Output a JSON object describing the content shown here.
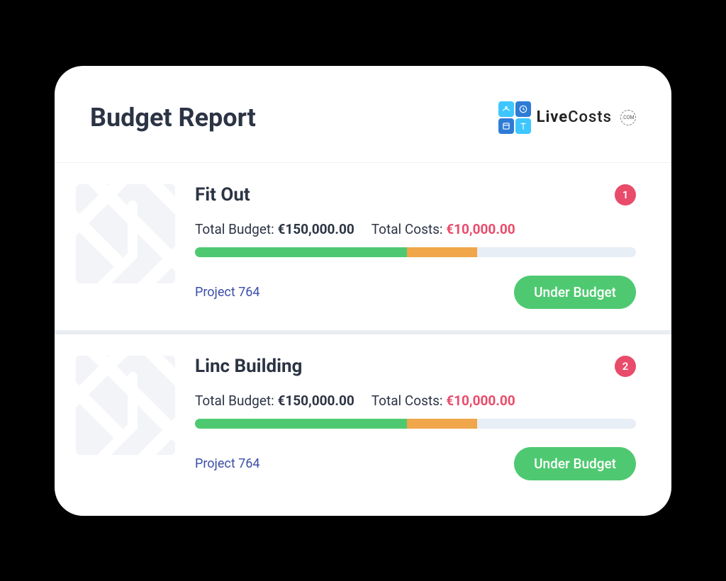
{
  "header": {
    "title": "Budget Report",
    "logo_text_bold": "Live",
    "logo_text_rest": "Costs",
    "logo_com": ".COM"
  },
  "labels": {
    "total_budget": "Total Budget:",
    "total_costs": "Total Costs:"
  },
  "projects": [
    {
      "name": "Fit Out",
      "badge": "1",
      "budget": "€150,000.00",
      "costs": "€10,000.00",
      "progress_green": 48,
      "progress_orange": 16,
      "link": "Project 764",
      "status": "Under Budget"
    },
    {
      "name": "Linc Building",
      "badge": "2",
      "budget": "€150,000.00",
      "costs": "€10,000.00",
      "progress_green": 48,
      "progress_orange": 16,
      "link": "Project 764",
      "status": "Under Budget"
    }
  ]
}
